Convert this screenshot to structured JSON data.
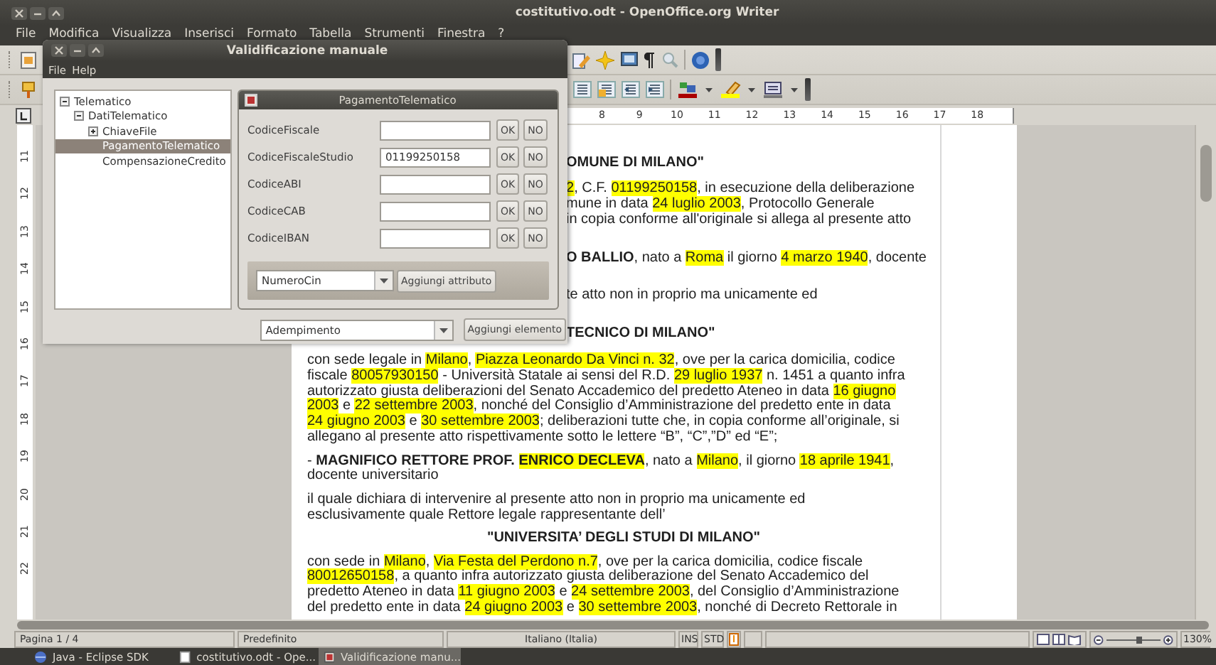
{
  "window": {
    "title": "costitutivo.odt - OpenOffice.org Writer"
  },
  "menu": [
    "File",
    "Modifica",
    "Visualizza",
    "Inserisci",
    "Formato",
    "Tabella",
    "Strumenti",
    "Finestra",
    "?"
  ],
  "ruler": {
    "labels": [
      "8",
      "9",
      "10",
      "11",
      "12",
      "13",
      "14",
      "15",
      "16",
      "17",
      "18"
    ]
  },
  "vertical_ruler": {
    "labels": [
      "11",
      "12",
      "13",
      "14",
      "15",
      "16",
      "17",
      "18",
      "19",
      "20",
      "21",
      "22"
    ]
  },
  "document": {
    "paragraphs": [
      {
        "kind": "heading",
        "lines": [
          [
            {
              "text": "OMUNE DI MILANO\"",
              "highlighted": false
            }
          ]
        ]
      },
      {
        "kind": "body",
        "lines": [
          [
            {
              "text": "2",
              "highlighted": true
            },
            {
              "text": ", C.F. ",
              "highlighted": false
            },
            {
              "text": "01199250158",
              "highlighted": true
            },
            {
              "text": ", in esecuzione della deliberazione",
              "highlighted": false
            }
          ],
          [
            {
              "text": "mune in data ",
              "highlighted": false
            },
            {
              "text": "24 luglio 2003",
              "highlighted": true
            },
            {
              "text": ", Protocollo Generale",
              "highlighted": false
            }
          ],
          [
            {
              "text": "in copia conforme all'originale si allega al presente atto",
              "highlighted": false
            }
          ]
        ]
      },
      {
        "kind": "body",
        "lines": [
          [
            {
              "text": "**O BALLIO**, nato a ",
              "highlighted": false
            },
            {
              "text": "Roma",
              "highlighted": true
            },
            {
              "text": " il giorno ",
              "highlighted": false
            },
            {
              "text": "4 marzo 1940",
              "highlighted": true
            },
            {
              "text": ", docente",
              "highlighted": false
            }
          ]
        ]
      },
      {
        "kind": "body",
        "lines": [
          [
            {
              "text": "te atto non in proprio ma unicamente ed",
              "highlighted": false
            }
          ]
        ]
      },
      {
        "kind": "heading",
        "lines": [
          [
            {
              "text": "TECNICO DI MILANO\"",
              "highlighted": false
            }
          ]
        ]
      },
      {
        "kind": "body",
        "lines": [
          [
            {
              "text": "con sede legale in ",
              "highlighted": false
            },
            {
              "text": "Milano",
              "highlighted": true
            },
            {
              "text": ", ",
              "highlighted": false
            },
            {
              "text": "Piazza Leonardo Da Vinci n. 32",
              "highlighted": true
            },
            {
              "text": ", ove per la carica domicilia, codice",
              "highlighted": false
            }
          ],
          [
            {
              "text": "fiscale ",
              "highlighted": false
            },
            {
              "text": "80057930150",
              "highlighted": true
            },
            {
              "text": " - Università Statale ai sensi del R.D. ",
              "highlighted": false
            },
            {
              "text": "29 luglio 1937",
              "highlighted": true
            },
            {
              "text": " n. 1451 a quanto infra",
              "highlighted": false
            }
          ],
          [
            {
              "text": "autorizzato giusta deliberazioni del Senato Accademico del predetto Ateneo in data ",
              "highlighted": false
            },
            {
              "text": "16 giugno",
              "highlighted": true
            }
          ],
          [
            {
              "text": "2003",
              "highlighted": true
            },
            {
              "text": " e ",
              "highlighted": false
            },
            {
              "text": "22 settembre 2003",
              "highlighted": true
            },
            {
              "text": ", nonché del Consiglio d’Amministrazione del predetto ente in data",
              "highlighted": false
            }
          ],
          [
            {
              "text": "24 giugno 2003",
              "highlighted": true
            },
            {
              "text": " e ",
              "highlighted": false
            },
            {
              "text": "30 settembre 2003",
              "highlighted": true
            },
            {
              "text": "; deliberazioni tutte che, in copia conforme all’originale, si",
              "highlighted": false
            }
          ],
          [
            {
              "text": "allegano al presente atto rispettivamente sotto le lettere “B”, “C”,”D” ed “E”;",
              "highlighted": false
            }
          ]
        ]
      },
      {
        "kind": "body",
        "lines": [
          [
            {
              "text": "- **MAGNIFICO RETTORE PROF.** ",
              "highlighted": false
            },
            {
              "text": "**ENRICO DECLEVA**",
              "highlighted": true
            },
            {
              "text": ", nato a ",
              "highlighted": false
            },
            {
              "text": "Milano",
              "highlighted": true
            },
            {
              "text": ", il giorno ",
              "highlighted": false
            },
            {
              "text": "18 aprile 1941",
              "highlighted": true
            },
            {
              "text": ",",
              "highlighted": false
            }
          ],
          [
            {
              "text": "docente universitario",
              "highlighted": false
            }
          ]
        ]
      },
      {
        "kind": "body",
        "lines": [
          [
            {
              "text": "il quale dichiara di intervenire al presente atto non in proprio ma unicamente ed",
              "highlighted": false
            }
          ],
          [
            {
              "text": "esclusivamente quale Rettore legale rappresentante dell’",
              "highlighted": false
            }
          ]
        ]
      },
      {
        "kind": "heading",
        "lines": [
          [
            {
              "text": "\"UNIVERSITA’ DEGLI STUDI DI MILANO\"",
              "highlighted": false
            }
          ]
        ]
      },
      {
        "kind": "body",
        "lines": [
          [
            {
              "text": "con sede in ",
              "highlighted": false
            },
            {
              "text": "Milano",
              "highlighted": true
            },
            {
              "text": ", ",
              "highlighted": false
            },
            {
              "text": "Via Festa del Perdono n.7",
              "highlighted": true
            },
            {
              "text": ", ove per la carica domicilia, codice fiscale",
              "highlighted": false
            }
          ],
          [
            {
              "text": "80012650158",
              "highlighted": true
            },
            {
              "text": ", a quanto infra autorizzato giusta deliberazione del Senato Accademico del",
              "highlighted": false
            }
          ],
          [
            {
              "text": "predetto Ateneo in data ",
              "highlighted": false
            },
            {
              "text": "11 giugno 2003",
              "highlighted": true
            },
            {
              "text": " e ",
              "highlighted": false
            },
            {
              "text": "24 settembre 2003",
              "highlighted": true
            },
            {
              "text": ", del Consiglio d’Amministrazione",
              "highlighted": false
            }
          ],
          [
            {
              "text": "del predetto ente in data ",
              "highlighted": false
            },
            {
              "text": "24 giugno 2003",
              "highlighted": true
            },
            {
              "text": " e ",
              "highlighted": false
            },
            {
              "text": "30 settembre 2003",
              "highlighted": true
            },
            {
              "text": ", nonché di Decreto Rettorale in",
              "highlighted": false
            }
          ]
        ]
      }
    ]
  },
  "dialog": {
    "title": "Validificazione manuale",
    "menu": [
      "File",
      "Help"
    ],
    "tree": [
      {
        "label": "Telematico",
        "expanded": true,
        "selected": false,
        "children": [
          {
            "label": "DatiTelematico",
            "expanded": true,
            "selected": false,
            "children": [
              {
                "label": "ChiaveFile",
                "expanded": false,
                "selected": false
              },
              {
                "label": "PagamentoTelematico",
                "selected": true
              },
              {
                "label": "CompensazioneCredito",
                "selected": false
              }
            ]
          }
        ]
      }
    ],
    "panel": {
      "title": "PagamentoTelematico",
      "fields": [
        {
          "label": "CodiceFiscale",
          "buttons": [
            "OK",
            "NO"
          ]
        },
        {
          "label": "CodiceFiscaleStudio",
          "value": "01199250158",
          "buttons": [
            "OK",
            "NO"
          ]
        },
        {
          "label": "CodiceABI",
          "buttons": [
            "OK",
            "NO"
          ]
        },
        {
          "label": "CodiceCAB",
          "buttons": [
            "OK",
            "NO"
          ]
        },
        {
          "label": "CodiceIBAN",
          "buttons": [
            "OK",
            "NO"
          ]
        }
      ],
      "attribute_select": "NumeroCin",
      "add_attribute_button": "Aggiungi attributo"
    },
    "element_select": "Adempimento",
    "add_element_button": "Aggiungi elemento"
  },
  "status_bar": {
    "page": "Pagina 1 / 4",
    "style": "Predefinito",
    "language": "Italiano (Italia)",
    "insert_mode": "INS",
    "selection_mode": "STD",
    "zoom_slider": {
      "level": 0.6
    },
    "zoom": "130%"
  },
  "taskbar": [
    {
      "label": "Java - Eclipse SDK",
      "selected": false
    },
    {
      "label": "costitutivo.odt - Ope...",
      "selected": false
    },
    {
      "label": "Validificazione manu...",
      "selected": true
    }
  ]
}
